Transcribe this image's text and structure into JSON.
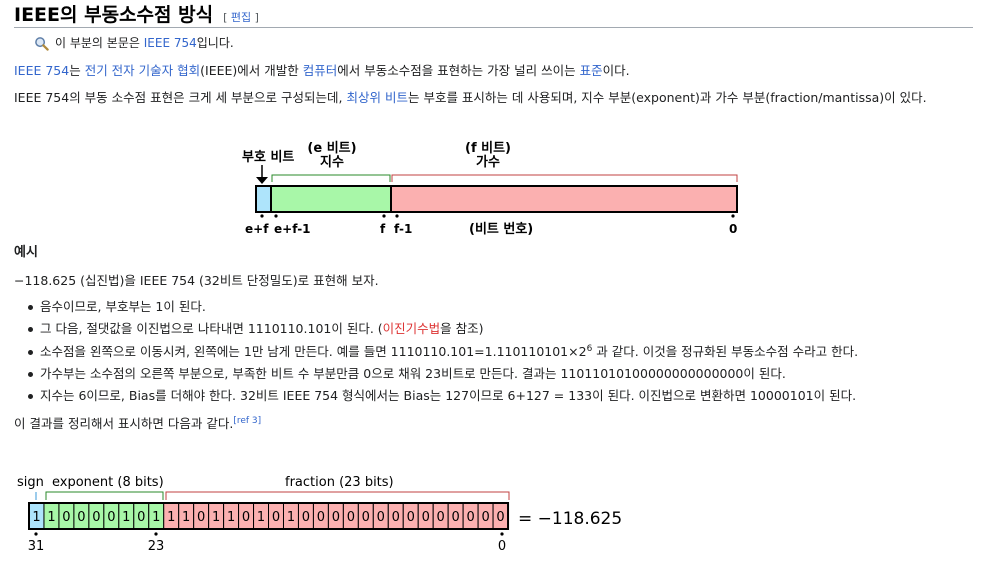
{
  "heading": {
    "title": "IEEE의 부동소수점 방식",
    "edit_open": "[ ",
    "edit_label": "편집",
    "edit_close": " ]"
  },
  "hatnote": {
    "prefix": "이 부분의 본문은 ",
    "link": "IEEE 754",
    "suffix": "입니다."
  },
  "para1": {
    "parts": [
      "IEEE 754",
      "는 ",
      "전기 전자 기술자 협회",
      "(IEEE)에서 개발한 ",
      "컴퓨터",
      "에서 부동소수점을 표현하는 가장 널리 쓰이는 ",
      "표준",
      "이다."
    ]
  },
  "para2": {
    "parts": [
      "IEEE 754의 부동 소수점 표현은 크게 세 부분으로 구성되는데, ",
      "최상위 비트",
      "는 부호를 표시하는 데 사용되며, 지수 부분(exponent)과 가수 부분(fraction/mantissa)이 있다."
    ]
  },
  "diagram1": {
    "sign_label": "부호 비트",
    "exp_label_1": "(e 비트)",
    "exp_label_2": "지수",
    "frac_label_1": "(f 비트)",
    "frac_label_2": "가수",
    "tick_ef": "e+f",
    "tick_ef1": "e+f-1",
    "tick_f": "f",
    "tick_f1": "f-1",
    "bit_num_label": "(비트 번호)",
    "tick_0": "0",
    "colors": {
      "sign": "#aee4fb",
      "exponent": "#a8f7a8",
      "fraction": "#fbb0b0"
    }
  },
  "example": {
    "title": "예시",
    "intro": "−118.625 (십진법)을 IEEE 754 (32비트 단정밀도)로 표현해 보자.",
    "bullets": [
      {
        "text": "음수이므로, 부호부는 1이 된다."
      },
      {
        "pre": "그 다음, 절댓값을 이진법으로 나타내면 1110110.101이 된다. (",
        "link": "이진기수법",
        "post": "을 참조)"
      },
      {
        "pre": "소수점을 왼쪽으로 이동시켜, 왼쪽에는 1만 남게 만든다. 예를 들면 1110110.101=1.110110101×2",
        "sup": "6",
        "post": " 과 같다. 이것을 정규화된 부동소수점 수라고 한다."
      },
      {
        "text": "가수부는 소수점의 오른쪽 부분으로, 부족한 비트 수 부분만큼 0으로 채워 23비트로 만든다. 결과는 11011010100000000000000이 된다."
      },
      {
        "text": "지수는 6이므로, Bias를 더해야 한다. 32비트 IEEE 754 형식에서는 Bias는 127이므로 6+127 = 133이 된다. 이진법으로 변환하면 10000101이 된다."
      }
    ],
    "summary": "이 결과를 정리해서 표시하면 다음과 같다.",
    "ref": "[ref 3]"
  },
  "diagram2": {
    "sign_label": "sign",
    "exp_label": "exponent (8 bits)",
    "frac_label": "fraction (23 bits)",
    "bits": [
      "1",
      "1",
      "0",
      "0",
      "0",
      "0",
      "1",
      "0",
      "1",
      "1",
      "1",
      "0",
      "1",
      "1",
      "0",
      "1",
      "0",
      "1",
      "0",
      "0",
      "0",
      "0",
      "0",
      "0",
      "0",
      "0",
      "0",
      "0",
      "0",
      "0",
      "0",
      "0"
    ],
    "equals": "= −118.625",
    "tick_31": "31",
    "tick_23": "23",
    "tick_0": "0",
    "colors": {
      "sign": "#aee4fb",
      "exponent": "#a8f7a8",
      "fraction": "#fbb0b0"
    }
  }
}
